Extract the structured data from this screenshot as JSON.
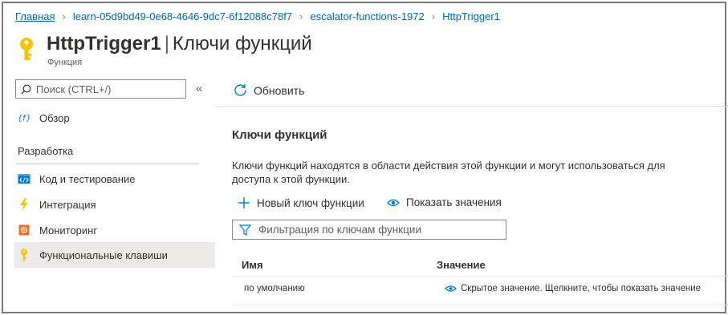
{
  "breadcrumb": {
    "items": [
      "Главная",
      "learn-05d9bd49-0e68-4646-9dc7-6f12088c78f7",
      "escalator-functions-1972",
      "HttpTrigger1"
    ]
  },
  "header": {
    "title": "HttpTrigger1",
    "separator": "|",
    "section": "Ключи функций",
    "subtitle": "Функция",
    "icon": "key-icon",
    "icon_color": "#f8c300"
  },
  "sidebar": {
    "search_placeholder": "Поиск (CTRL+/)",
    "collapse_label": "«",
    "overview": {
      "label": "Обзор",
      "icon": "function-icon"
    },
    "section_label": "Разработка",
    "items": [
      {
        "label": "Код и тестирование",
        "icon": "code-icon"
      },
      {
        "label": "Интеграция",
        "icon": "lightning-icon"
      },
      {
        "label": "Мониторинг",
        "icon": "monitor-icon"
      },
      {
        "label": "Функциональные клавиши",
        "icon": "key-icon",
        "active": true
      }
    ]
  },
  "toolbar": {
    "refresh_label": "Обновить"
  },
  "main": {
    "title": "Ключи функций",
    "description": "Ключи функций находятся в области действия этой функции и могут использоваться для доступа к этой функции.",
    "new_key_label": "Новый ключ функции",
    "show_values_label": "Показать значения",
    "filter_placeholder": "Фильтрация по ключам функции",
    "table": {
      "columns": [
        "Имя",
        "Значение"
      ],
      "rows": [
        {
          "name": "по умолчанию",
          "value": "Скрытое значение. Щелкните, чтобы показать значение"
        }
      ]
    }
  },
  "colors": {
    "link": "#0066b4",
    "accent": "#0078d4",
    "active_bg": "#edebe9",
    "key_yellow": "#f8c300"
  }
}
